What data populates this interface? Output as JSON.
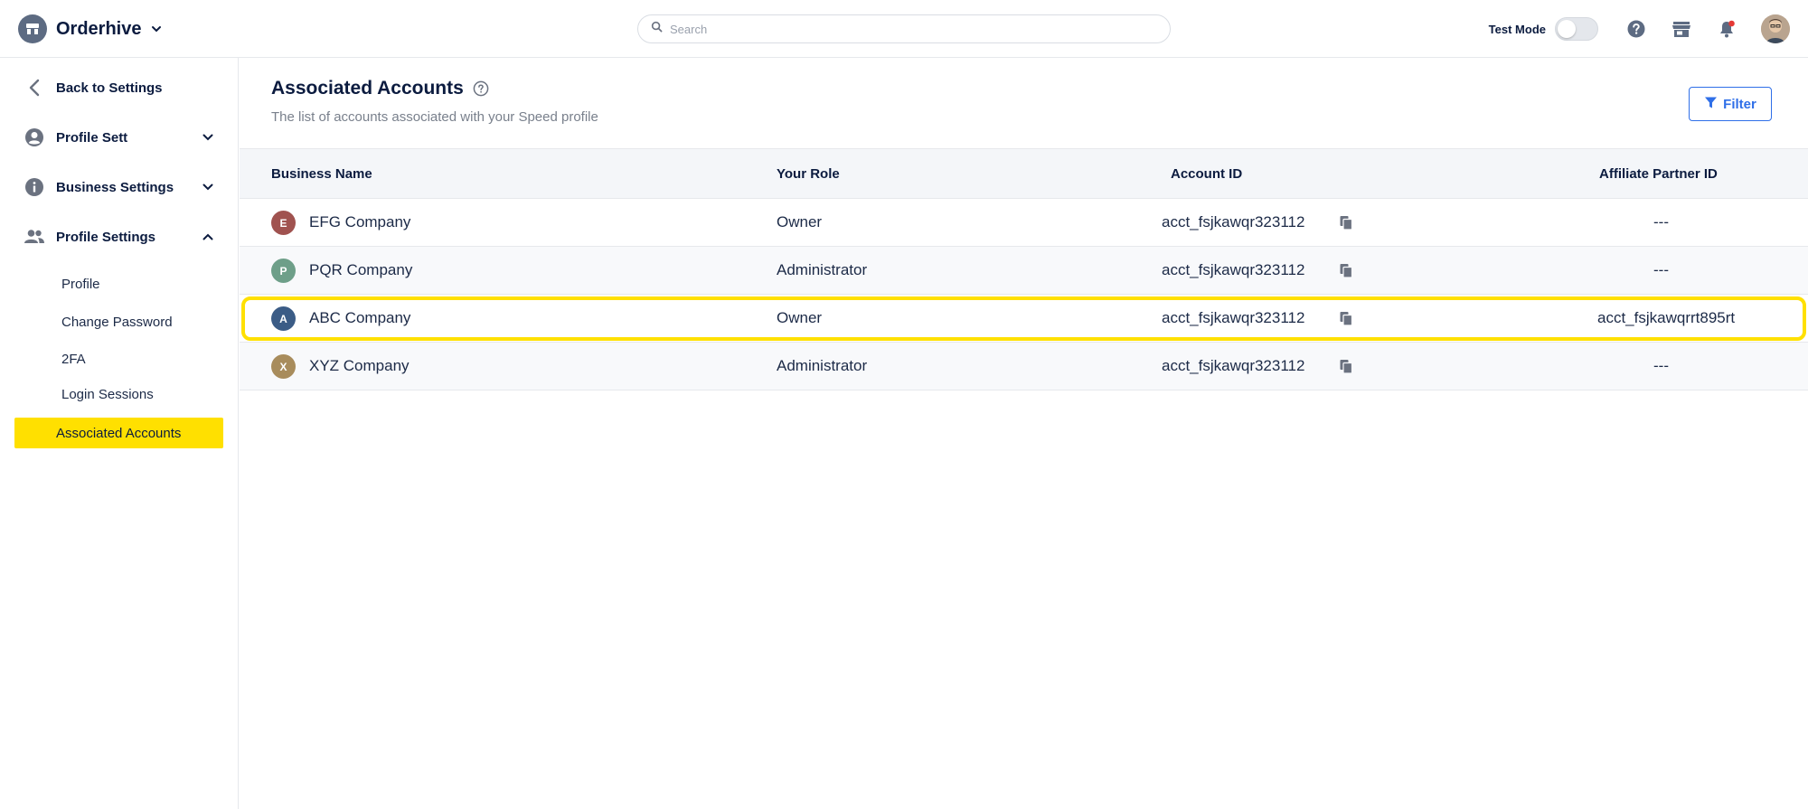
{
  "app": {
    "name": "Orderhive"
  },
  "search": {
    "placeholder": "Search"
  },
  "header": {
    "test_mode_label": "Test Mode",
    "test_mode_on": false
  },
  "sidebar": {
    "back_label": "Back to Settings",
    "sections": [
      {
        "label": "Profile Sett",
        "icon": "account-circle-icon",
        "expanded": false
      },
      {
        "label": "Business Settings",
        "icon": "info-icon",
        "expanded": false
      },
      {
        "label": "Profile Settings",
        "icon": "people-icon",
        "expanded": true
      }
    ],
    "sub_items": [
      "Profile",
      "Change Password",
      "2FA",
      "Login Sessions"
    ],
    "active_item": "Associated Accounts"
  },
  "main": {
    "title": "Associated Accounts",
    "subtitle": "The list of accounts associated with your Speed profile",
    "filter_label": "Filter"
  },
  "table": {
    "columns": [
      "Business Name",
      "Your Role",
      "Account ID",
      "Affiliate Partner ID"
    ],
    "rows": [
      {
        "initial": "E",
        "color": "#a0524f",
        "name": "EFG Company",
        "role": "Owner",
        "account_id": "acct_fsjkawqr323112",
        "affiliate": "---"
      },
      {
        "initial": "P",
        "color": "#6e9f89",
        "name": "PQR Company",
        "role": "Administrator",
        "account_id": "acct_fsjkawqr323112",
        "affiliate": "---"
      },
      {
        "initial": "A",
        "color": "#3b5c86",
        "name": "ABC Company",
        "role": "Owner",
        "account_id": "acct_fsjkawqr323112",
        "affiliate": "acct_fsjkawqrrt895rt"
      },
      {
        "initial": "X",
        "color": "#a88c5c",
        "name": "XYZ Company",
        "role": "Administrator",
        "account_id": "acct_fsjkawqr323112",
        "affiliate": "---"
      }
    ],
    "highlighted_row": 2
  },
  "colors": {
    "accent": "#2f6fe8",
    "highlight": "#ffe000",
    "text": "#0b1b3f"
  }
}
